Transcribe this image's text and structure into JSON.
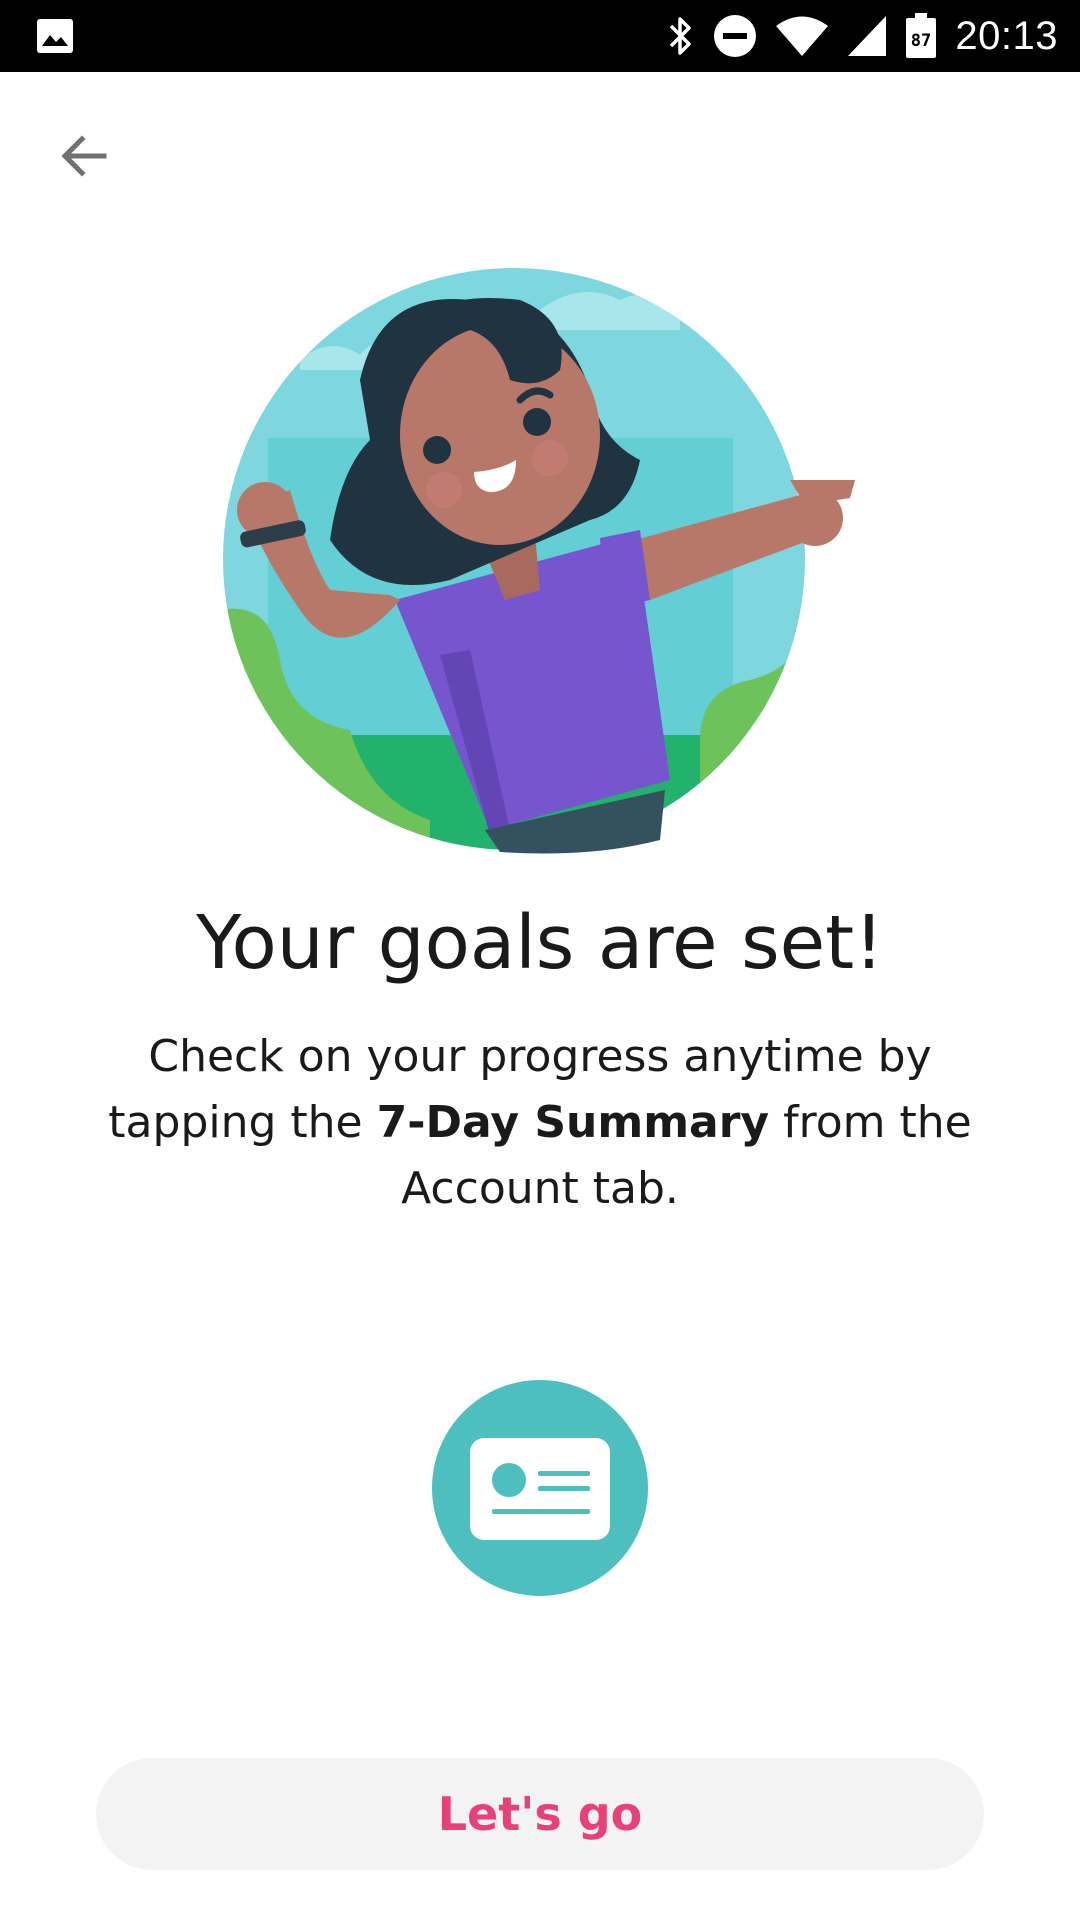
{
  "status_bar": {
    "time": "20:13",
    "battery_level": "87",
    "icons": [
      "gallery-icon",
      "bluetooth-icon",
      "do-not-disturb-icon",
      "wifi-icon",
      "cell-signal-icon",
      "battery-icon"
    ]
  },
  "nav": {
    "back_icon": "arrow-back-icon"
  },
  "hero": {
    "illustration": "celebrating-person-illustration"
  },
  "content": {
    "title": "Your goals are set!",
    "body_prefix": "Check on your progress anytime by tapping the ",
    "body_bold": "7-Day Summary",
    "body_suffix": " from the Account tab.",
    "summary_icon": "summary-card-icon"
  },
  "actions": {
    "primary_label": "Let's go"
  },
  "colors": {
    "accent": "#e8407a",
    "teal": "#4dbfbf",
    "button_bg": "#f3f3f3",
    "status_bar_bg": "#000000"
  }
}
